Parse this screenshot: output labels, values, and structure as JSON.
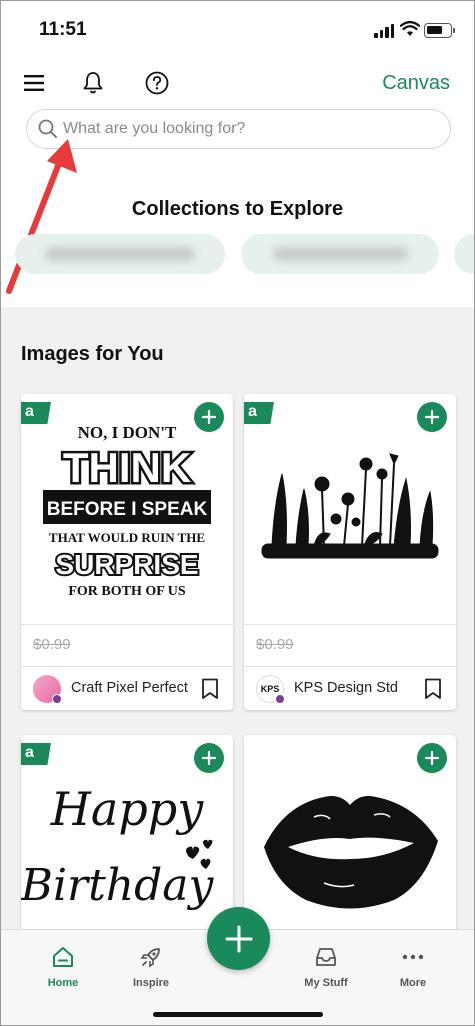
{
  "status_bar": {
    "time": "11:51"
  },
  "header": {
    "canvas_label": "Canvas"
  },
  "search": {
    "placeholder": "What are you looking for?"
  },
  "collections": {
    "title": "Collections to Explore"
  },
  "images_section": {
    "title": "Images for You",
    "cards": [
      {
        "art_lines": [
          "NO, I DON'T",
          "THINK",
          "BEFORE I SPEAK",
          "THAT WOULD RUIN THE",
          "SURPRISE",
          "FOR BOTH OF US"
        ],
        "price": "$0.99",
        "seller": "Craft Pixel Perfect"
      },
      {
        "art": "wildflower-silhouette",
        "price": "$0.99",
        "seller": "KPS Design Std",
        "seller_avatar_text": "KPS"
      },
      {
        "art_lines": [
          "Happy",
          "Birthday"
        ]
      },
      {
        "art": "lips-silhouette"
      }
    ]
  },
  "nav": {
    "home": "Home",
    "inspire": "Inspire",
    "my_stuff": "My Stuff",
    "more": "More"
  },
  "colors": {
    "brand_green": "#1a8a5a",
    "annotation_red": "#e83a3a"
  }
}
